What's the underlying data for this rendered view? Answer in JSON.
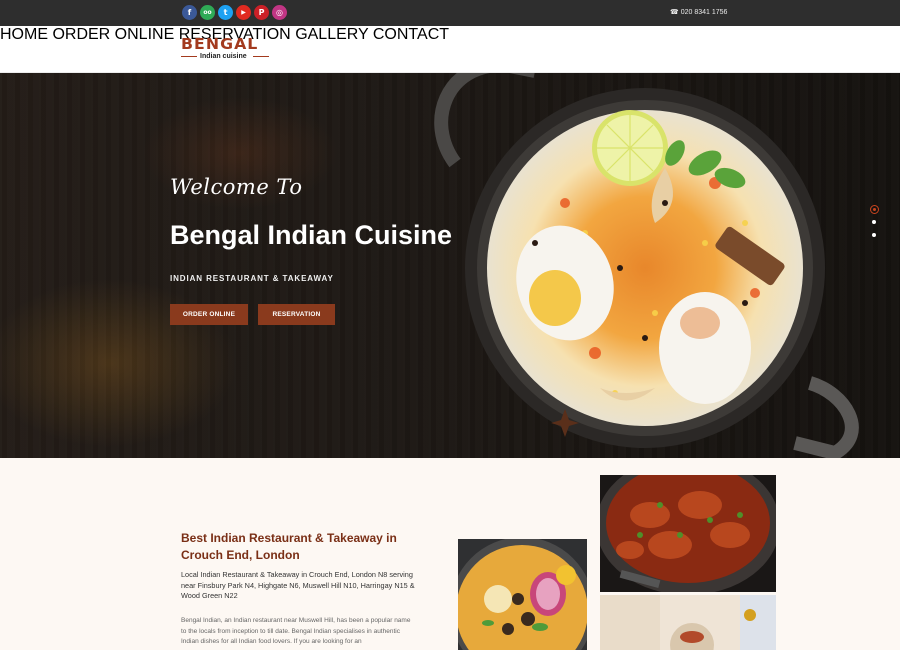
{
  "social": [
    {
      "icon": "facebook-icon",
      "glyph": "f",
      "color": "#3b5998"
    },
    {
      "icon": "tripadvisor-icon",
      "glyph": "oo",
      "color": "#2faa56"
    },
    {
      "icon": "twitter-icon",
      "glyph": "t",
      "color": "#1da1f2"
    },
    {
      "icon": "youtube-icon",
      "glyph": "▶",
      "color": "#e02a20"
    },
    {
      "icon": "pinterest-icon",
      "glyph": "P",
      "color": "#cb2027"
    },
    {
      "icon": "instagram-icon",
      "glyph": "◎",
      "color": "#c13584"
    }
  ],
  "topbar": {
    "phone": "020 8341 1756"
  },
  "logo": {
    "main": "BENGAL",
    "sub": "Indian cuisine"
  },
  "nav": [
    "HOME",
    "ORDER ONLINE",
    "RESERVATION",
    "GALLERY",
    "CONTACT"
  ],
  "hero": {
    "welcome": "Welcome To",
    "title": "Bengal Indian Cuisine",
    "subtitle": "INDIAN RESTAURANT & TAKEAWAY",
    "btn_order": "ORDER ONLINE",
    "btn_reservation": "RESERVATION",
    "slides": 3,
    "active_slide": 1
  },
  "about": {
    "title": "Best Indian Restaurant & Takeaway in Crouch End, London",
    "p1": "Local Indian Restaurant & Takeaway in Crouch End, London N8 serving near Finsbury Park N4, Highgate N6, Muswell Hill N10, Harringay N15 & Wood Green N22",
    "p2": "Bengal Indian, an Indian restaurant near Muswell Hill, has been a popular name to the locals from inception to till date. Bengal Indian specialises in authentic Indian dishes for all Indian food lovers. If you are looking for an"
  },
  "colors": {
    "accent": "#8a3a1d",
    "heading": "#7a2f16",
    "topbar": "#2e2e2e"
  }
}
